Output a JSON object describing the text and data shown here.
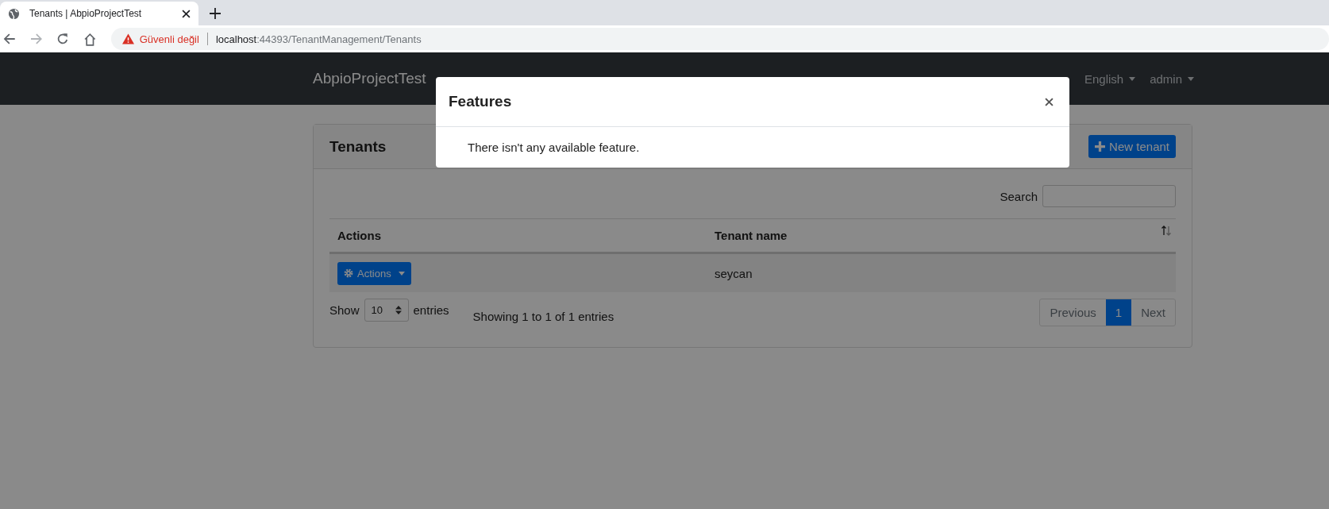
{
  "browser": {
    "tab_title": "Tenants | AbpioProjectTest",
    "security_label": "Güvenli değil",
    "url_host": "localhost",
    "url_path": ":44393/TenantManagement/Tenants"
  },
  "navbar": {
    "brand": "AbpioProjectTest",
    "language": "English",
    "user": "admin"
  },
  "card": {
    "title": "Tenants",
    "new_button": "New tenant",
    "search_label": "Search",
    "columns": [
      {
        "label": "Actions",
        "sortable": false
      },
      {
        "label": "Tenant name",
        "sortable": true
      }
    ],
    "rows": [
      {
        "action": "Actions",
        "tenant_name": "seycan"
      }
    ],
    "length_label_before": "Show",
    "length_value": "10",
    "length_label_after": "entries",
    "info": "Showing 1 to 1 of 1 entries",
    "pagination": [
      {
        "label": "Previous",
        "selected": false
      },
      {
        "label": "1",
        "selected": true
      },
      {
        "label": "Next",
        "selected": false
      }
    ]
  },
  "modal": {
    "title": "Features",
    "message": "There isn't any available feature."
  }
}
